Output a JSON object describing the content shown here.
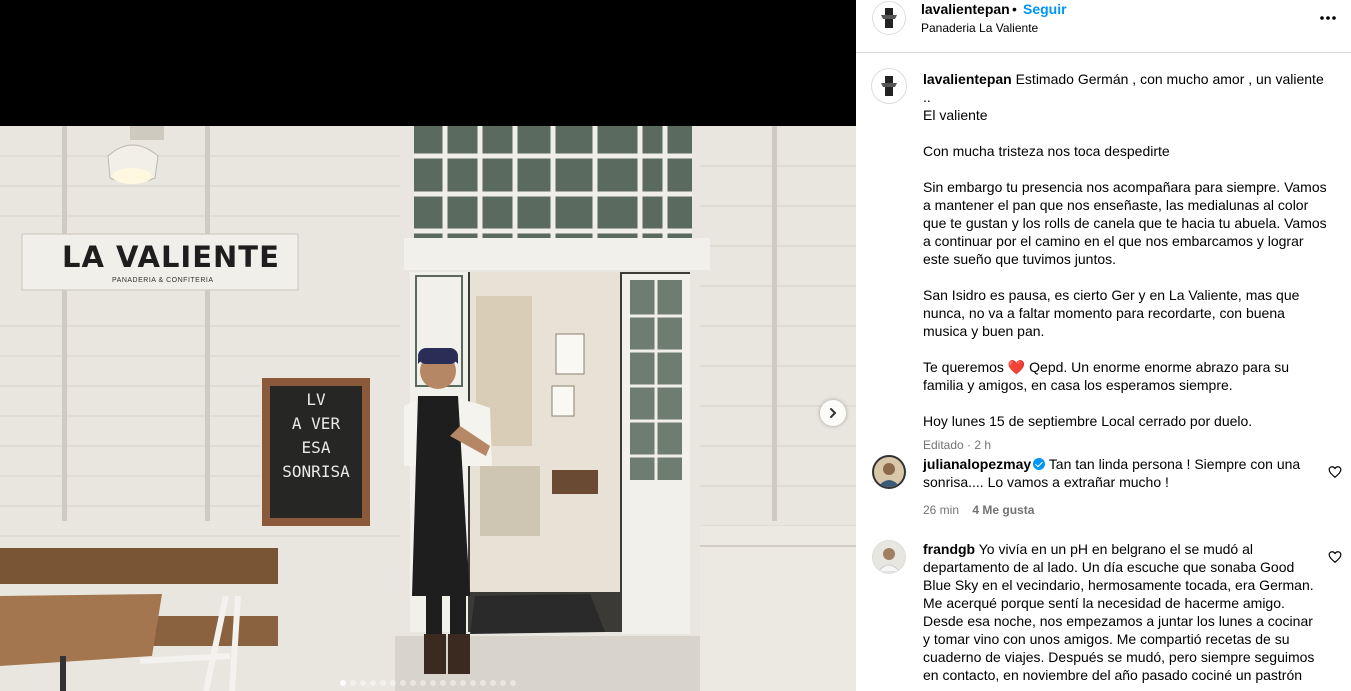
{
  "post": {
    "username": "lavalientepan",
    "follow_label": "Seguir",
    "location": "Panaderia La Valiente",
    "more_icon": "more-horizontal-icon"
  },
  "photo": {
    "sign_main": "LA VALIENTE",
    "sign_sub": "PANADERIA & CONFITERIA",
    "chalk_lines": [
      "LV",
      "A VER",
      "ESA",
      "SONRISA"
    ],
    "carousel_count": 18,
    "carousel_active": 0
  },
  "caption": {
    "username": "lavalientepan",
    "line1": "Estimado Germán , con mucho amor , un valiente ..",
    "line2": "El valiente",
    "p2": "Con mucha tristeza nos toca despedirte",
    "p3": "Sin embargo tu presencia nos acompañara para siempre. Vamos a mantener el pan que nos enseñaste, las medialunas al color que te gustan y los rolls de canela que te hacia tu abuela. Vamos a continuar por el camino en el que nos embarcamos y lograr este sueño que tuvimos juntos.",
    "p4": "San Isidro es pausa, es cierto Ger y en La Valiente, mas que nunca, no va a faltar momento para recordarte, con buena musica y buen pan.",
    "p5_a": "Te queremos",
    "p5_emoji": "❤️",
    "p5_b": "Qepd. Un enorme enorme abrazo para su familia y amigos, en casa los esperamos siempre.",
    "p6": "Hoy lunes 15 de septiembre Local cerrado por duelo.",
    "meta": "Editado · 2 h"
  },
  "comments": [
    {
      "username": "julianalopezmay",
      "verified": true,
      "text": "Tan tan linda persona ! Siempre con una sonrisa.... Lo vamos a extrañar mucho !",
      "time": "26 min",
      "likes": "4 Me gusta"
    },
    {
      "username": "frandgb",
      "verified": false,
      "text": "Yo vivía en un pH en belgrano el se mudó al departamento de al lado. Un día escuche que sonaba Good Blue Sky en el vecindario, hermosamente tocada, era German. Me acerqué porque sentí la necesidad de hacerme amigo. Desde esa noche, nos empezamos a juntar los lunes a cocinar y tomar vino con unos amigos. Me compartió recetas de su cuaderno de viajes. Después se mudó, pero siempre seguimos en contacto, en noviembre del año pasado cociné un pastrón"
    }
  ],
  "colors": {
    "link": "#0095f6",
    "muted": "#737373",
    "divider": "#dbdbdb"
  }
}
